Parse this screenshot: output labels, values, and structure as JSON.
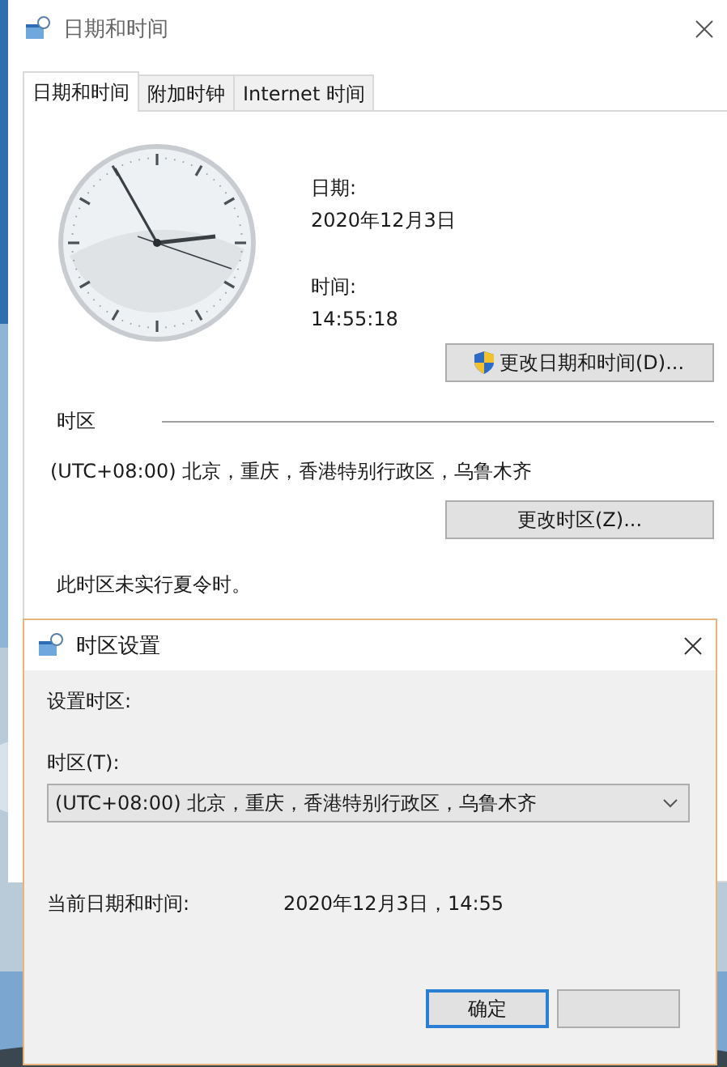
{
  "main_window": {
    "title": "日期和时间",
    "tabs": [
      {
        "label": "日期和时间",
        "selected": true
      },
      {
        "label": "附加时钟",
        "selected": false
      },
      {
        "label": "Internet 时间",
        "selected": false
      }
    ],
    "date_label": "日期:",
    "date": "2020年12月3日",
    "time_label": "时间:",
    "time": "14:55:18",
    "change_datetime_button": "更改日期和时间(D)...",
    "timezone_heading": "时区",
    "timezone": "(UTC+08:00) 北京，重庆，香港特别行政区，乌鲁木齐",
    "change_timezone_button": "更改时区(Z)...",
    "dst_note": "此时区未实行夏令时。"
  },
  "dialog": {
    "title": "时区设置",
    "heading": "设置时区:",
    "timezone_label": "时区(T):",
    "timezone_value": "(UTC+08:00) 北京，重庆，香港特别行政区，乌鲁木齐",
    "current_label": "当前日期和时间:",
    "current_value": "2020年12月3日，14:55",
    "ok_button": "确定"
  }
}
